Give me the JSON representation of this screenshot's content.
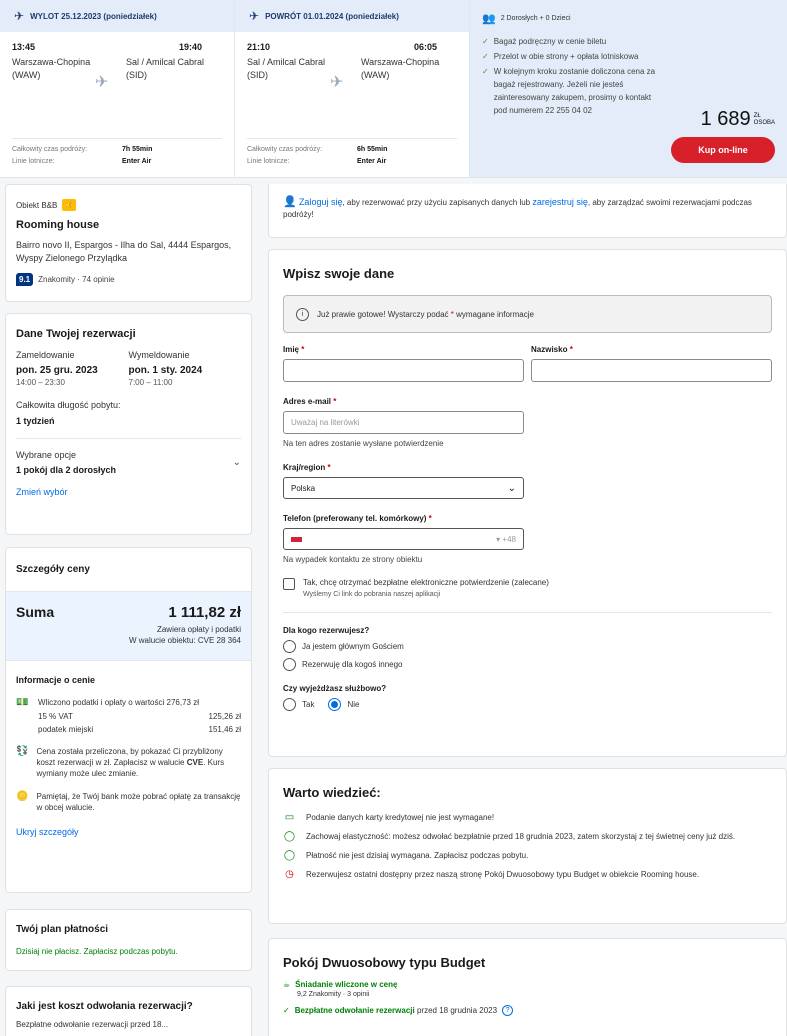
{
  "flight": {
    "outbound": {
      "label": "WYLOT 25.12.2023 (poniedziałek)",
      "dep_time": "13:45",
      "arr_time": "19:40",
      "dep_city": "Warszawa-Chopina (WAW)",
      "arr_city": "Sal / Amilcal Cabral (SID)",
      "duration_label": "Całkowity czas podróży:",
      "duration": "7h 55min",
      "airline_label": "Linie lotnicze:",
      "airline": "Enter Air"
    },
    "return": {
      "label": "POWRÓT 01.01.2024 (poniedziałek)",
      "dep_time": "21:10",
      "arr_time": "06:05",
      "dep_city": "Sal / Amilcal Cabral (SID)",
      "arr_city": "Warszawa-Chopina (WAW)",
      "duration_label": "Całkowity czas podróży:",
      "duration": "6h 55min",
      "airline_label": "Linie lotnicze:",
      "airline": "Enter Air"
    },
    "passengers": "2 Dorosłych + 0 Dzieci",
    "benefits": [
      "Bagaż podręczny w cenie biletu",
      "Przelot w obie strony + opłata lotniskowa",
      "W kolejnym kroku zostanie doliczona cena za bagaż rejestrowany. Jeżeli nie jesteś zainteresowany zakupem, prosimy o kontakt pod numerem 22 255 04 02"
    ],
    "price": "1 689",
    "price_unit_1": "ZŁ",
    "price_unit_2": "OSOBA",
    "buy_label": "Kup on-line"
  },
  "hotel": {
    "type": "Obiekt B&B",
    "name": "Rooming house",
    "address": "Bairro novo II, Espargos - Ilha do Sal, 4444 Espargos, Wyspy Zielonego Przylądka",
    "score": "9.1",
    "score_text": "Znakomity · 74 opinie"
  },
  "reservation": {
    "title": "Dane Twojej rezerwacji",
    "checkin_label": "Zameldowanie",
    "checkin_date": "pon. 25 gru. 2023",
    "checkin_time": "14:00 – 23:30",
    "checkout_label": "Wymeldowanie",
    "checkout_date": "pon. 1 sty. 2024",
    "checkout_time": "7:00 – 11:00",
    "length_label": "Całkowita długość pobytu:",
    "length": "1 tydzień",
    "options_label": "Wybrane opcje",
    "options": "1 pokój dla 2 dorosłych",
    "change_label": "Zmień wybór"
  },
  "price_details": {
    "title": "Szczegóły ceny",
    "total_label": "Suma",
    "total": "1 111,82 zł",
    "total_note_1": "Zawiera opłaty i podatki",
    "total_note_2": "W walucie obiektu: CVE 28 364",
    "info_title": "Informacje o cenie",
    "taxes": "Wliczono podatki i opłaty o wartości 276,73 zł",
    "vat_label": "15 % VAT",
    "vat": "125,26 zł",
    "city_tax_label": "podatek miejski",
    "city_tax": "151,46 zł",
    "conversion_a": "Cena została przeliczona, by pokazać Ci przybliżony koszt rezerwacji w zł. Zapłacisz w walucie ",
    "conversion_currency": "CVE",
    "conversion_b": ". Kurs wymiany może ulec zmianie.",
    "bank_fee": "Pamiętaj, że Twój bank może pobrać opłatę za transakcję w obcej walucie.",
    "hide_label": "Ukryj szczegóły"
  },
  "plan": {
    "title": "Twój plan płatności",
    "text": "Dzisiaj nie płacisz. Zapłacisz podczas pobytu."
  },
  "cancel": {
    "title": "Jaki jest koszt odwołania rezerwacji?",
    "text": "Bezpłatne odwołanie rezerwacji przed 18..."
  },
  "login": {
    "link": "Zaloguj się",
    "text_a": ", aby rezerwować przy użyciu zapisanych danych lub ",
    "register": "zarejestruj się",
    "text_b": ", aby zarządzać swoimi rezerwacjami podczas podróży!"
  },
  "form": {
    "title": "Wpisz swoje dane",
    "notice_a": "Już prawie gotowe! Wystarczy podać ",
    "notice_b": " wymagane informacje",
    "first_name_label": "Imię",
    "last_name_label": "Nazwisko",
    "email_label": "Adres e-mail",
    "email_placeholder": "Uważaj na literówki",
    "email_hint": "Na ten adres zostanie wysłane potwierdzenie",
    "country_label": "Kraj/region",
    "country": "Polska",
    "phone_label": "Telefon (preferowany tel. komórkowy)",
    "phone_code": "+48",
    "phone_hint": "Na wypadek kontaktu ze strony obiektu",
    "econfirm": "Tak, chcę otrzymać bezpłatne elektroniczne potwierdzenie (zalecane)",
    "econfirm_sub": "Wyślemy Ci link do pobrania naszej aplikacji",
    "who_label": "Dla kogo rezerwujesz?",
    "who_opt1": "Ja jestem głównym Gościem",
    "who_opt2": "Rezerwuję dla kogoś innego",
    "business_label": "Czy wyjeżdżasz służbowo?",
    "business_yes": "Tak",
    "business_no": "Nie"
  },
  "know": {
    "title": "Warto wiedzieć:",
    "items": [
      "Podanie danych karty kredytowej nie jest wymagane!",
      "Zachowaj elastyczność: możesz odwołać bezpłatnie przed 18 grudnia 2023, zatem skorzystaj z tej świetnej ceny już dziś.",
      "Płatność nie jest dzisiaj wymagana. Zapłacisz podczas pobytu.",
      "Rezerwujesz ostatni dostępny przez naszą stronę Pokój Dwuosobowy typu Budget w obiekcie Rooming house."
    ]
  },
  "room": {
    "title": "Pokój Dwuosobowy typu Budget",
    "breakfast": "Śniadanie wliczone w cenę",
    "breakfast_sub": "9,2 Znakomity · 3 opinii",
    "free_cancel": "Bezpłatne odwołanie rezerwacji",
    "free_cancel_rest": " przed 18 grudnia 2023"
  }
}
